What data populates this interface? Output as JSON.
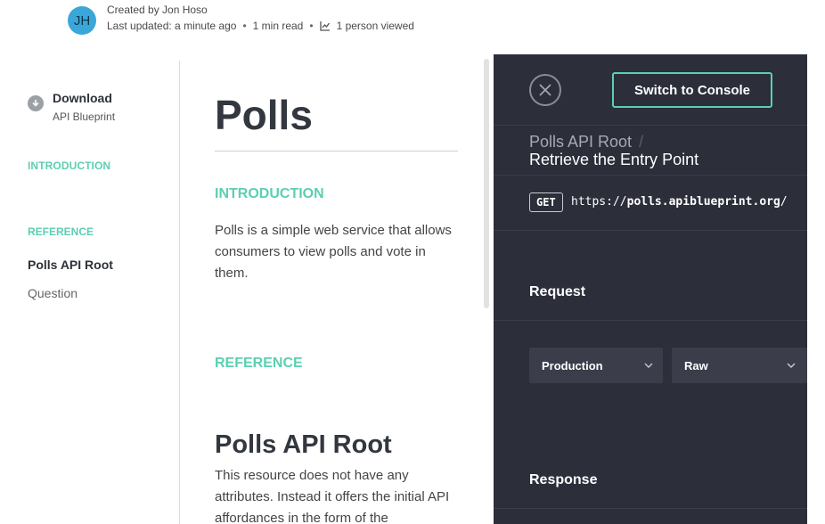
{
  "header": {
    "avatar_initials": "JH",
    "created_by": "Created by Jon Hoso",
    "last_updated": "Last updated: a minute ago",
    "read_time": "1 min read",
    "views": "1 person viewed"
  },
  "sidebar": {
    "download_title": "Download",
    "download_subtitle": "API Blueprint",
    "items": [
      {
        "label": "INTRODUCTION"
      },
      {
        "label": "REFERENCE"
      },
      {
        "label": "Polls API Root"
      },
      {
        "label": "Question"
      }
    ]
  },
  "content": {
    "title": "Polls",
    "intro_heading": "INTRODUCTION",
    "intro_text": "Polls is a simple web service that allows consumers to view polls and vote in them.",
    "reference_heading": "REFERENCE",
    "resource_title": "Polls API Root",
    "resource_text": "This resource does not have any attributes. Instead it offers the initial API affordances in the form of the"
  },
  "console": {
    "switch_label": "Switch to Console",
    "breadcrumb_parent": "Polls API Root",
    "breadcrumb_separator": "/",
    "breadcrumb_current": "Retrieve the Entry Point",
    "method": "GET",
    "url_scheme": "https://",
    "url_host": "polls.apiblueprint.org",
    "url_path": "/",
    "request_title": "Request",
    "environment_value": "Production",
    "format_value": "Raw",
    "response_title": "Response"
  },
  "colors": {
    "accent": "#5ccfb1",
    "panel_bg": "#2c2e3a",
    "avatar_bg": "#3aa7d8"
  }
}
